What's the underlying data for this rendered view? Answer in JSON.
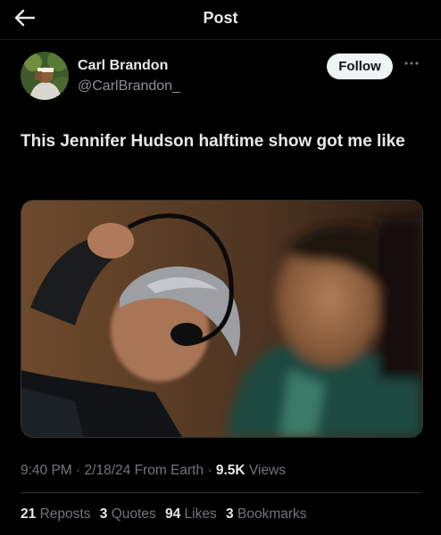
{
  "header": {
    "title": "Post"
  },
  "author": {
    "name": "Carl Brandon",
    "handle": "@CarlBrandon_",
    "follow_label": "Follow"
  },
  "post": {
    "text": "This Jennifer Hudson halftime show got me like",
    "media_icon": "photo-two-men-headset"
  },
  "meta": {
    "time": "9:40 PM",
    "sep1": "·",
    "date": "2/18/24",
    "source": "From Earth",
    "sep2": "·",
    "views_count": "9.5K",
    "views_label": "Views"
  },
  "stats": {
    "reposts_count": "21",
    "reposts_label": "Reposts",
    "quotes_count": "3",
    "quotes_label": "Quotes",
    "likes_count": "94",
    "likes_label": "Likes",
    "bookmarks_count": "3",
    "bookmarks_label": "Bookmarks"
  },
  "icons": {
    "back": "arrow-left-icon",
    "more": "more-dots-icon"
  }
}
